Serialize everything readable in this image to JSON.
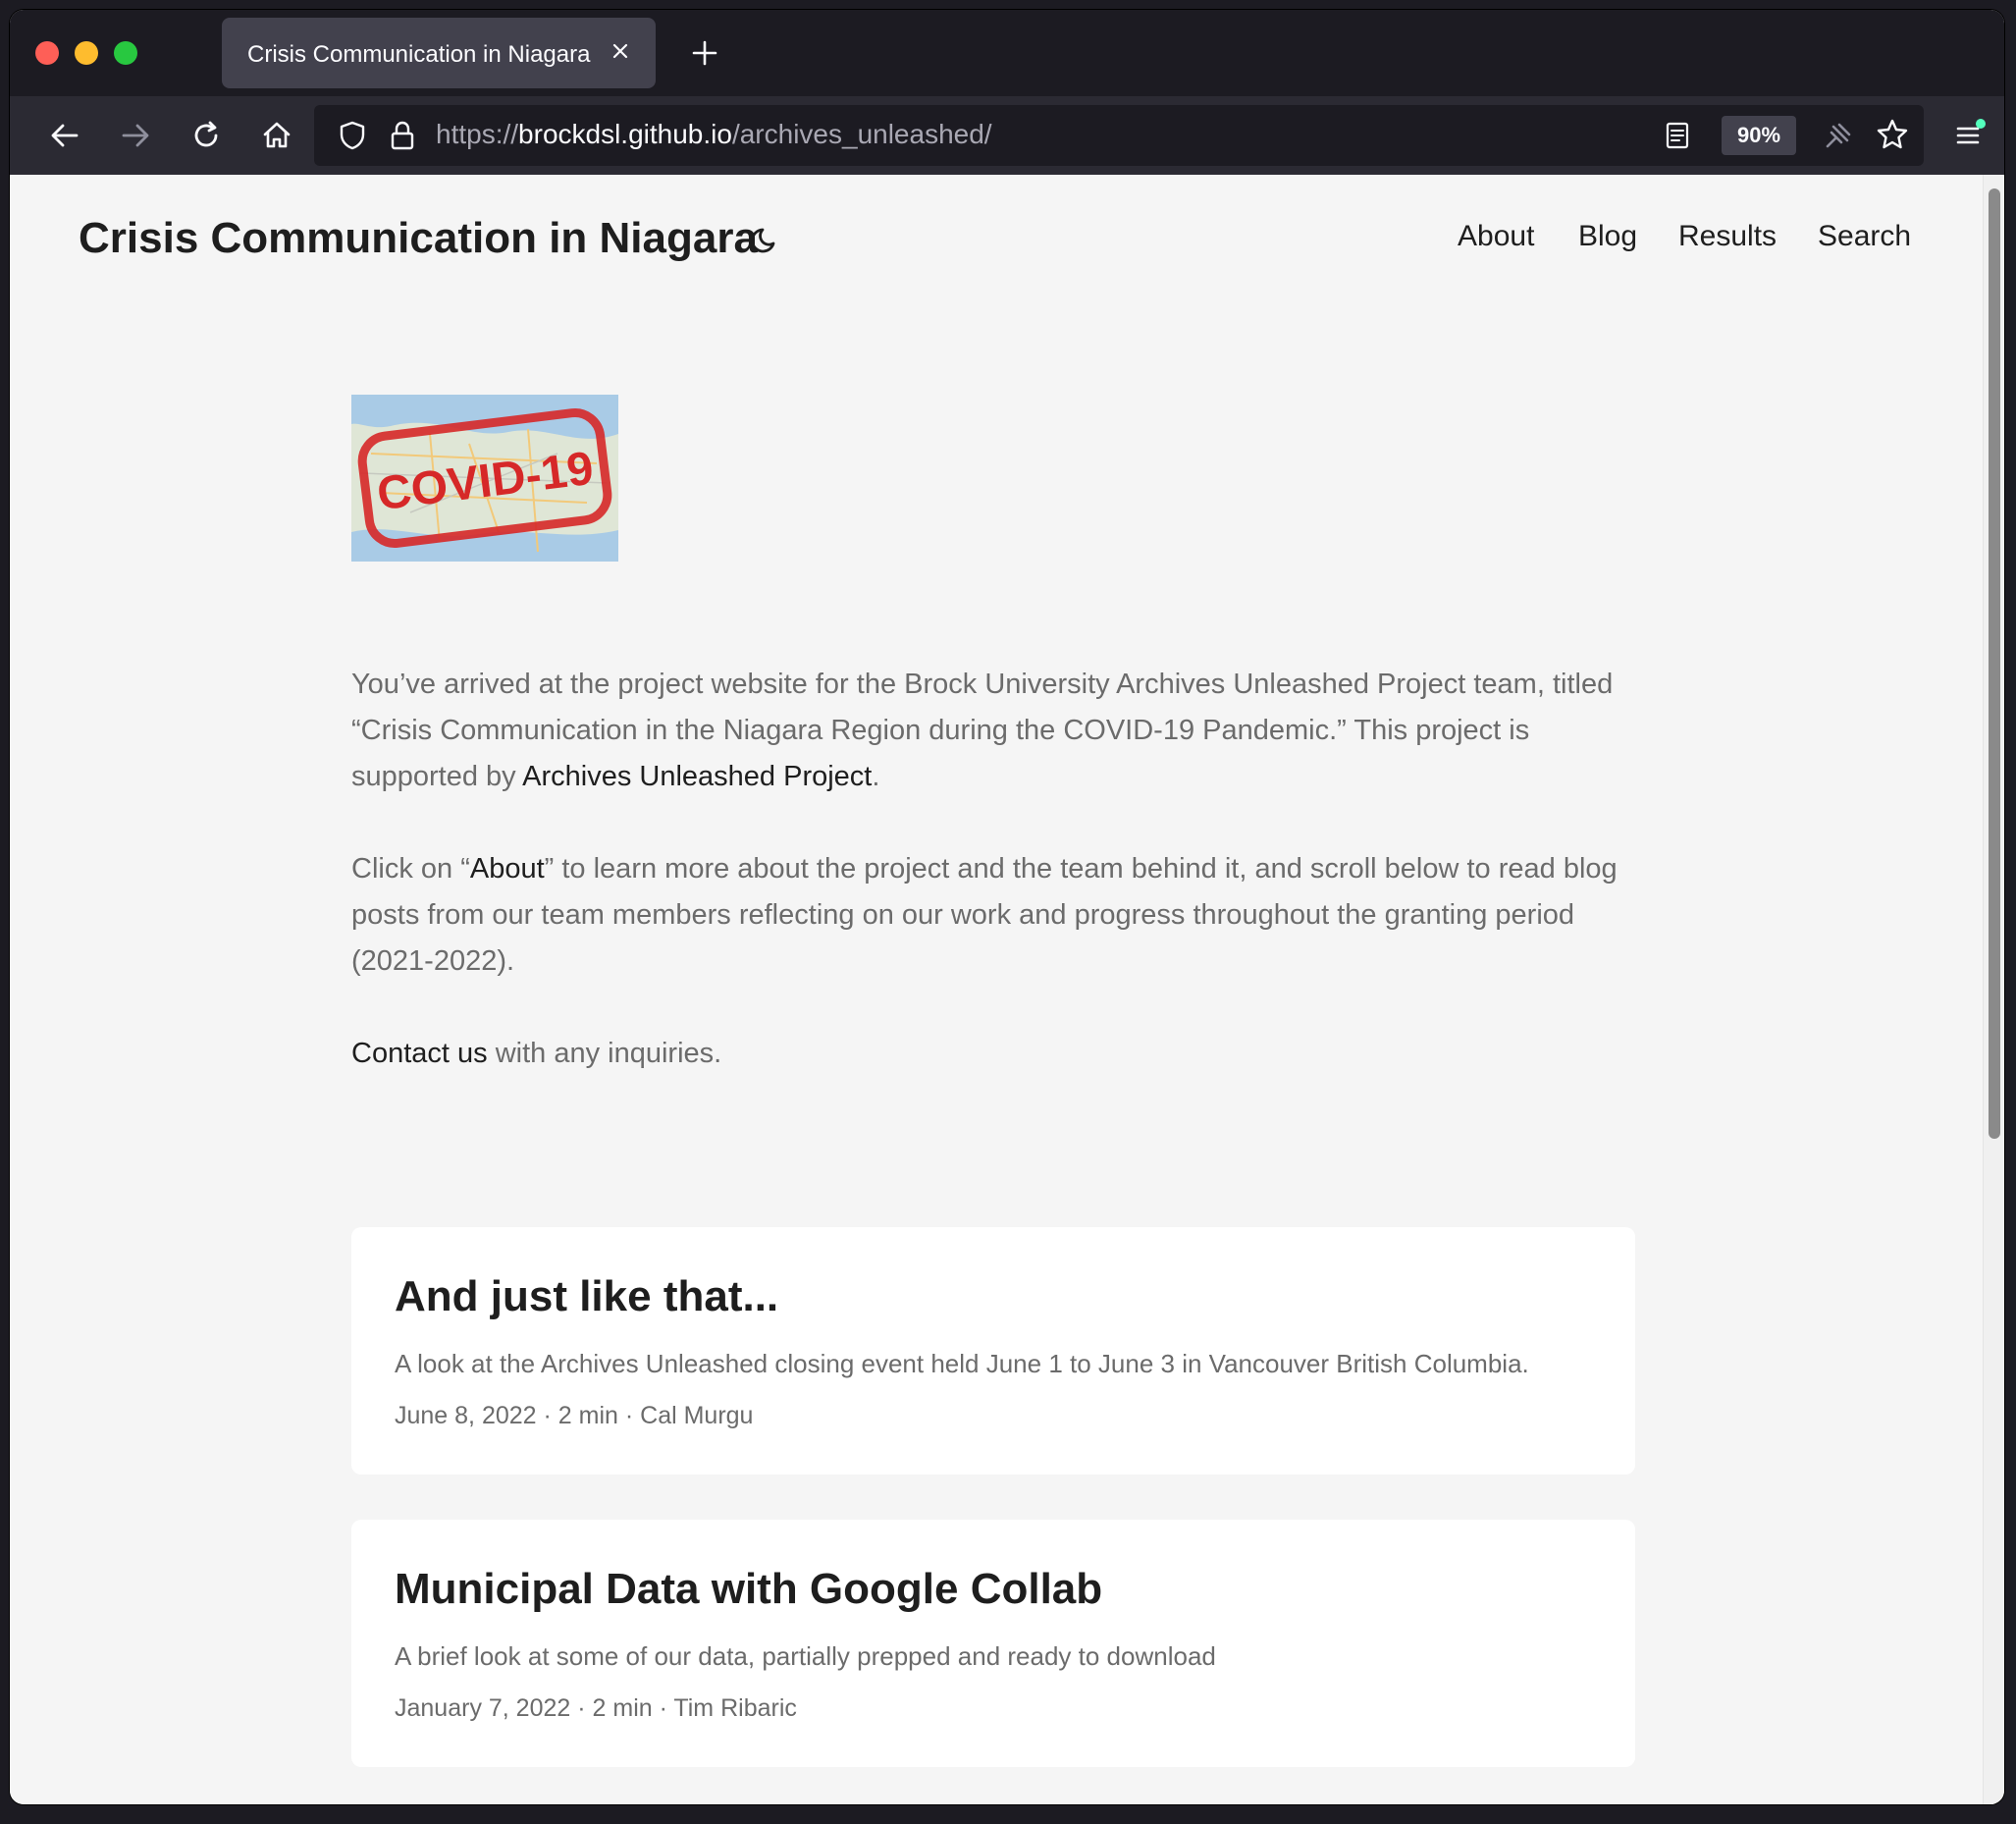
{
  "browser": {
    "tab_title": "Crisis Communication in Niagara",
    "url_scheme": "https://",
    "url_host": "brockdsl.github.io",
    "url_path": "/archives_unleashed/",
    "zoom_level": "90%"
  },
  "site": {
    "title": "Crisis Communication in Niagara",
    "nav": [
      "About",
      "Blog",
      "Results",
      "Search"
    ]
  },
  "hero": {
    "image_text": "COVID-19"
  },
  "intro": {
    "p1_text_a": "You’ve arrived at the project website for the Brock University Archives Unleashed Project team, titled “Crisis Communication in the Niagara Region during the COVID-19 Pandemic.” This project is supported by ",
    "p1_link": "Archives Unleashed Project",
    "p1_text_b": ".",
    "p2_text_a": "Click on “",
    "p2_link": "About",
    "p2_text_b": "” to learn more about the project and the team behind it, and scroll below to read blog posts from our team members reflecting on our work and progress throughout the granting period (2021-2022).",
    "p3_link": "Contact us",
    "p3_text": " with any inquiries."
  },
  "posts": [
    {
      "title": "And just like that...",
      "description": "A look at the Archives Unleashed closing event held June 1 to June 3 in Vancouver British Columbia.",
      "meta": "June 8, 2022 · 2 min · Cal Murgu"
    },
    {
      "title": "Municipal Data with Google Collab",
      "description": "A brief look at some of our data, partially prepped and ready to download",
      "meta": "January 7, 2022 · 2 min · Tim Ribaric"
    }
  ]
}
